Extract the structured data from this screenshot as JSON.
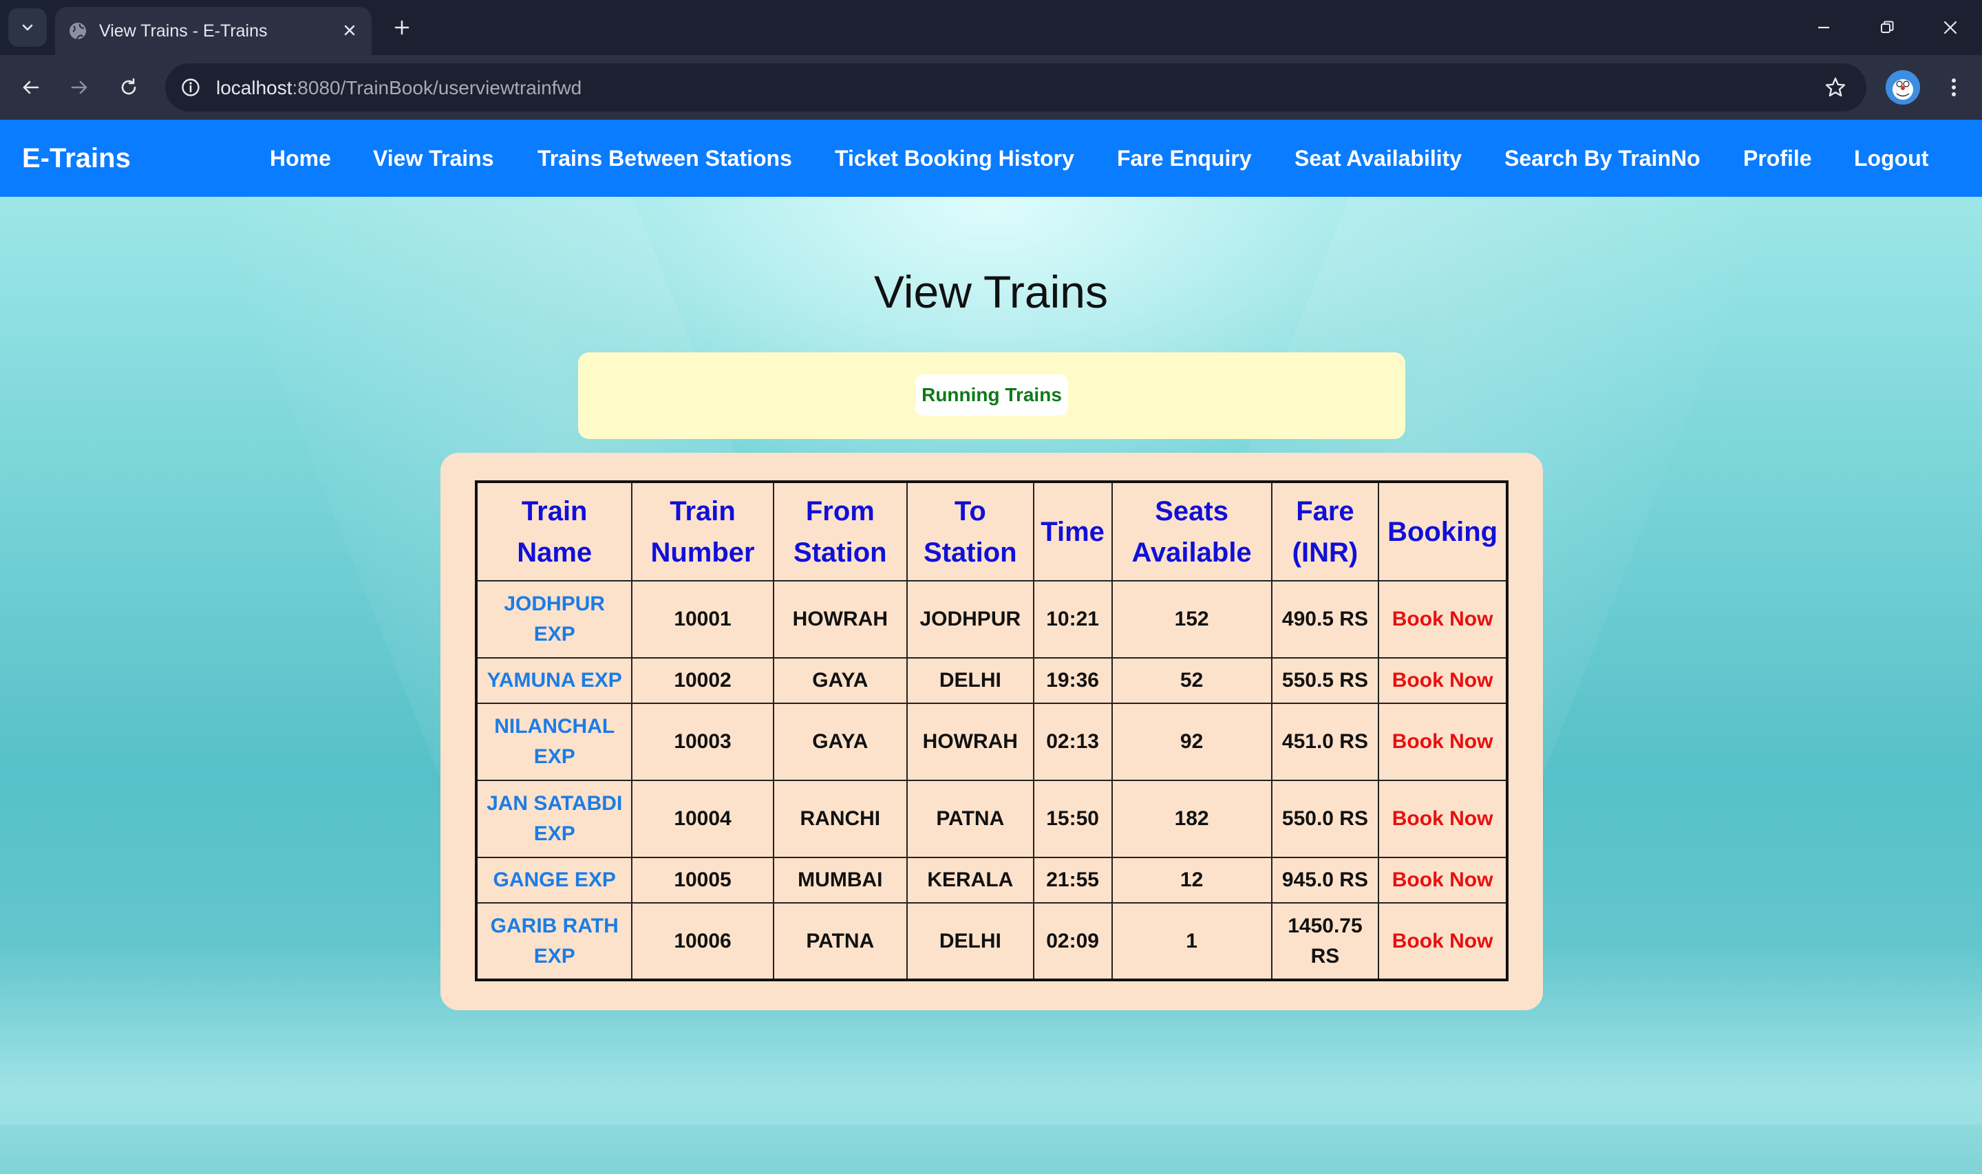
{
  "browser": {
    "tab_title": "View Trains - E-Trains",
    "url_host": "localhost",
    "url_rest": ":8080/TrainBook/userviewtrainfwd"
  },
  "navbar": {
    "brand": "E-Trains",
    "items": [
      {
        "label": "Home"
      },
      {
        "label": "View Trains"
      },
      {
        "label": "Trains Between Stations"
      },
      {
        "label": "Ticket Booking History"
      },
      {
        "label": "Fare Enquiry"
      },
      {
        "label": "Seat Availability"
      },
      {
        "label": "Search By TrainNo"
      },
      {
        "label": "Profile"
      },
      {
        "label": "Logout"
      }
    ]
  },
  "main": {
    "title": "View Trains",
    "notice": "Running Trains",
    "table": {
      "headers": [
        {
          "line1": "Train",
          "line2": "Name"
        },
        {
          "line1": "Train",
          "line2": "Number"
        },
        {
          "line1": "From",
          "line2": "Station"
        },
        {
          "line1": "To",
          "line2": "Station"
        },
        {
          "line1": "Time",
          "line2": ""
        },
        {
          "line1": "Seats",
          "line2": "Available"
        },
        {
          "line1": "Fare",
          "line2": "(INR)"
        },
        {
          "line1": "Booking",
          "line2": ""
        }
      ],
      "rows": [
        {
          "name": "JODHPUR EXP",
          "number": "10001",
          "from": "HOWRAH",
          "to": "JODHPUR",
          "time": "10:21",
          "seats": "152",
          "fare": "490.5 RS",
          "action": "Book Now"
        },
        {
          "name": "YAMUNA EXP",
          "number": "10002",
          "from": "GAYA",
          "to": "DELHI",
          "time": "19:36",
          "seats": "52",
          "fare": "550.5 RS",
          "action": "Book Now"
        },
        {
          "name": "NILANCHAL EXP",
          "number": "10003",
          "from": "GAYA",
          "to": "HOWRAH",
          "time": "02:13",
          "seats": "92",
          "fare": "451.0 RS",
          "action": "Book Now"
        },
        {
          "name": "JAN SATABDI EXP",
          "number": "10004",
          "from": "RANCHI",
          "to": "PATNA",
          "time": "15:50",
          "seats": "182",
          "fare": "550.0 RS",
          "action": "Book Now"
        },
        {
          "name": "GANGE EXP",
          "number": "10005",
          "from": "MUMBAI",
          "to": "KERALA",
          "time": "21:55",
          "seats": "12",
          "fare": "945.0 RS",
          "action": "Book Now"
        },
        {
          "name": "GARIB RATH EXP",
          "number": "10006",
          "from": "PATNA",
          "to": "DELHI",
          "time": "02:09",
          "seats": "1",
          "fare": "1450.75 RS",
          "action": "Book Now"
        }
      ]
    }
  }
}
